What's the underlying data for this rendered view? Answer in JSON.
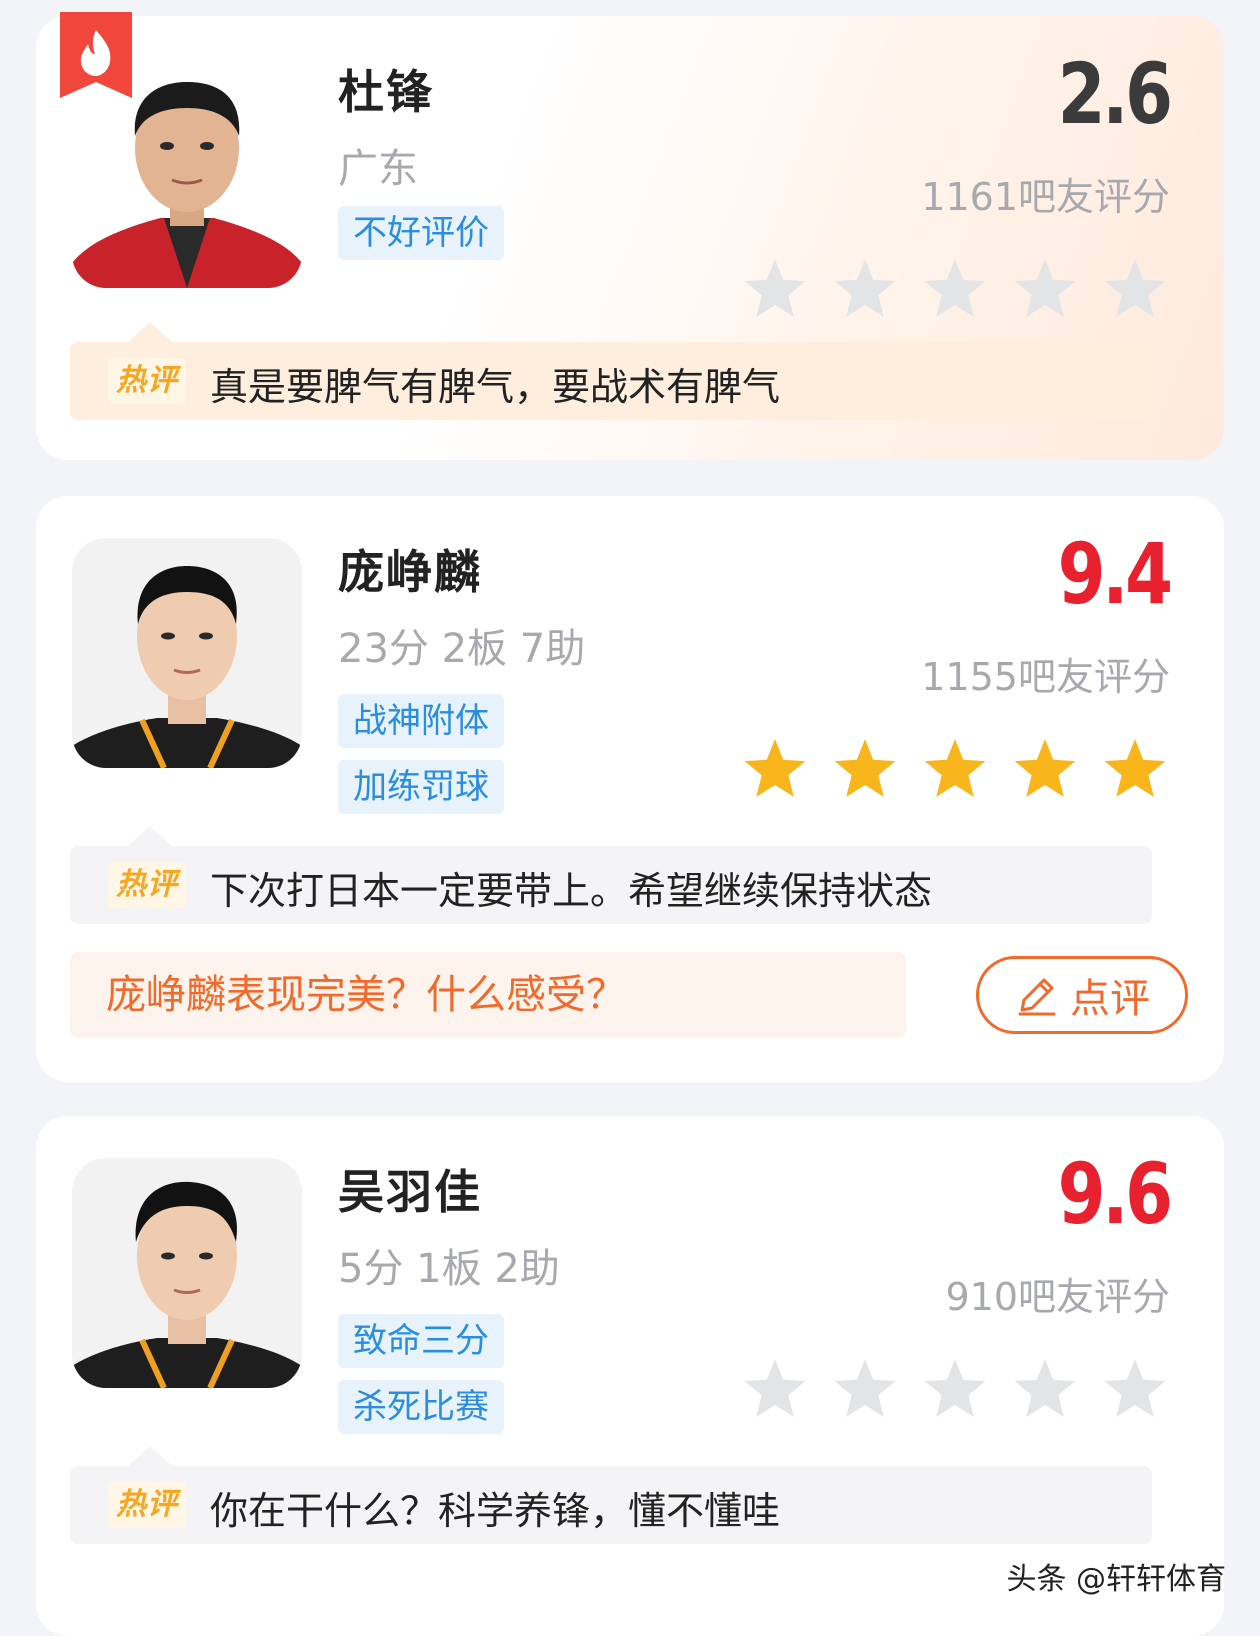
{
  "colors": {
    "score_high": "#e8212f",
    "score_low": "#3b3b3b",
    "star_filled": "#f8b51c",
    "star_empty": "#e3e4e6",
    "tag_text": "#2a8de0",
    "accent_orange": "#f26a2b"
  },
  "cards": [
    {
      "name": "杜锋",
      "subline": "广东",
      "tags": [
        "不好评价"
      ],
      "score": "2.6",
      "votes": "1161吧友评分",
      "stars_filled": 0,
      "stars_total": 5,
      "hot_label": "热评",
      "hot_comment": "真是要脾气有脾气，要战术有脾气",
      "hot_badge_icon": "flame-icon"
    },
    {
      "name": "庞峥麟",
      "subline": "23分 2板 7助",
      "tags": [
        "战神附体",
        "加练罚球"
      ],
      "score": "9.4",
      "votes": "1155吧友评分",
      "stars_filled": 5,
      "stars_total": 5,
      "hot_label": "热评",
      "hot_comment": "下次打日本一定要带上。希望继续保持状态",
      "question": "庞峥麟表现完美？什么感受？",
      "review_button": "点评",
      "review_icon": "pencil-icon"
    },
    {
      "name": "吴羽佳",
      "subline": "5分 1板 2助",
      "tags": [
        "致命三分",
        "杀死比赛"
      ],
      "score": "9.6",
      "votes": "910吧友评分",
      "stars_filled": 0,
      "stars_total": 5,
      "hot_label": "热评",
      "hot_comment": "你在干什么？科学养锋，懂不懂哇"
    }
  ],
  "watermark": "头条 @轩轩体育"
}
